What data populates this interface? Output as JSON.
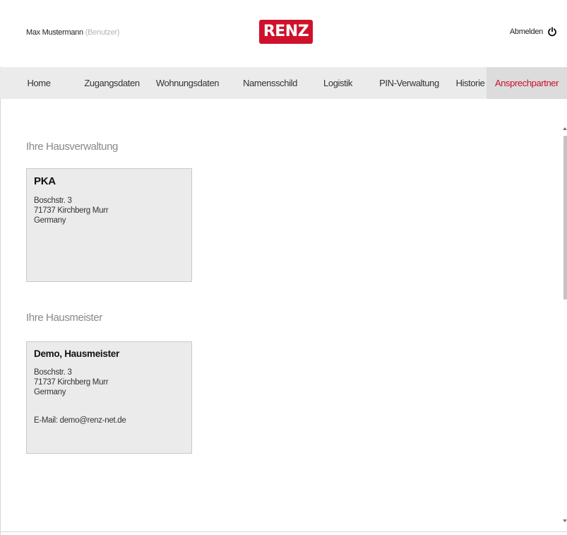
{
  "header": {
    "user_name": "Max Mustermann",
    "user_role": "(Benutzer)",
    "logo_text": "RENZ",
    "logout_label": "Abmelden",
    "brand_color": "#d0112b"
  },
  "nav": {
    "items": [
      {
        "label": "Home",
        "active": false
      },
      {
        "label": "Zugangsdaten",
        "active": false
      },
      {
        "label": "Wohnungsdaten",
        "active": false
      },
      {
        "label": "Namensschild",
        "active": false
      },
      {
        "label": "Logistik",
        "active": false
      },
      {
        "label": "PIN-Verwaltung",
        "active": false
      },
      {
        "label": "Historie",
        "active": false
      },
      {
        "label": "Ansprechpartner",
        "active": true
      }
    ],
    "active_color": "#c8102e"
  },
  "property_management": {
    "title": "Ihre Hausverwaltung",
    "card": {
      "name": "PKA",
      "street": "Boschstr. 3",
      "city": "71737 Kirchberg Murr",
      "country": "Germany"
    }
  },
  "caretaker": {
    "title": "Ihre Hausmeister",
    "card": {
      "name": "Demo, Hausmeister",
      "street": "Boschstr. 3",
      "city": "71737 Kirchberg Murr",
      "country": "Germany",
      "email_label": "E-Mail:",
      "email": "demo@renz-net.de"
    }
  }
}
